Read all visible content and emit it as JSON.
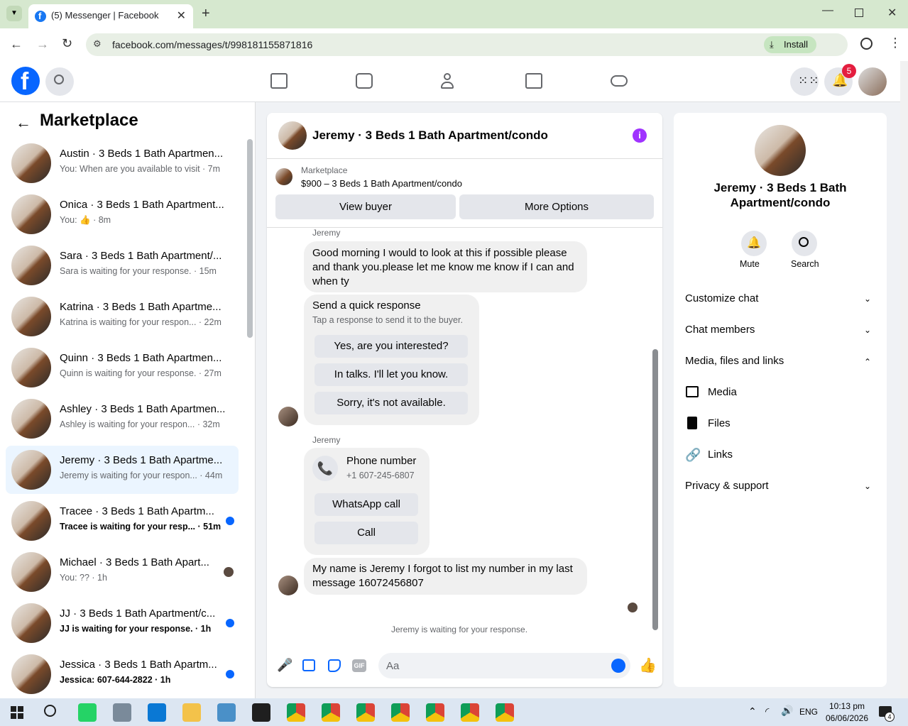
{
  "browser": {
    "tab_title": "(5) Messenger | Facebook",
    "url": "facebook.com/messages/t/998181155871816",
    "install_label": "Install"
  },
  "header": {
    "notification_count": "5"
  },
  "left": {
    "title": "Marketplace",
    "conversations": [
      {
        "name": "Austin · 3 Beds 1 Bath Apartmen...",
        "preview": "You: When are you available to visit · 7m",
        "unread": false
      },
      {
        "name": "Onica · 3 Beds 1 Bath Apartment...",
        "preview": "You: 👍 · 8m",
        "unread": false
      },
      {
        "name": "Sara · 3 Beds 1 Bath Apartment/...",
        "preview": "Sara is waiting for your response. · 15m",
        "unread": false
      },
      {
        "name": "Katrina · 3 Beds 1 Bath Apartme...",
        "preview": "Katrina is waiting for your respon... · 22m",
        "unread": false
      },
      {
        "name": "Quinn · 3 Beds 1 Bath Apartmen...",
        "preview": "Quinn is waiting for your response. · 27m",
        "unread": false
      },
      {
        "name": "Ashley · 3 Beds 1 Bath Apartmen...",
        "preview": "Ashley is waiting for your respon... · 32m",
        "unread": false
      },
      {
        "name": "Jeremy · 3 Beds 1 Bath Apartme...",
        "preview": "Jeremy is waiting for your respon... · 44m",
        "unread": false,
        "active": true
      },
      {
        "name": "Tracee · 3 Beds 1 Bath Apartm...",
        "preview": "Tracee is waiting for your resp... · 51m",
        "unread": true
      },
      {
        "name": "Michael · 3 Beds 1 Bath Apart...",
        "preview": "You: ?? · 1h",
        "unread": false,
        "seen": true
      },
      {
        "name": "JJ · 3 Beds 1 Bath Apartment/c...",
        "preview": "JJ is waiting for your response. · 1h",
        "unread": true
      },
      {
        "name": "Jessica · 3 Beds 1 Bath Apartm...",
        "preview": "Jessica: 607-644-2822 · 1h",
        "unread": true
      }
    ]
  },
  "chat": {
    "title": "Jeremy · 3 Beds 1 Bath Apartment/condo",
    "listing_source": "Marketplace",
    "listing_price_title": "$900 – 3 Beds 1 Bath Apartment/condo",
    "view_buyer": "View buyer",
    "more_options": "More Options",
    "sender_label_1": "Jeremy",
    "message_1": "Good morning I would to look at this if possible please and thank you.please let me know me know if I can and when ty",
    "quick_title": "Send a quick response",
    "quick_sub": "Tap a response to send it to the buyer.",
    "quick_options": [
      "Yes, are you interested?",
      "In talks. I'll let you know.",
      "Sorry, it's not available."
    ],
    "sender_label_2": "Jeremy",
    "phone_title": "Phone number",
    "phone_value": "+1 607-245-6807",
    "whatsapp_call": "WhatsApp call",
    "call": "Call",
    "message_2": "My name is Jeremy I forgot to list my number in my last message 16072456807",
    "waiting": "Jeremy is waiting for your response.",
    "composer_placeholder": "Aa"
  },
  "right": {
    "title": "Jeremy · 3 Beds 1 Bath Apartment/condo",
    "mute": "Mute",
    "search": "Search",
    "sections": [
      "Customize chat",
      "Chat members",
      "Media, files and links"
    ],
    "media": "Media",
    "files": "Files",
    "links": "Links",
    "privacy": "Privacy & support"
  },
  "taskbar": {
    "lang": "ENG",
    "time": "10:13 pm",
    "date": "06/06/2026",
    "notif_count": "4"
  },
  "colors": {
    "brand": "#0866ff",
    "accent_purple": "#a033ff",
    "unread_dot": "#0866ff"
  }
}
